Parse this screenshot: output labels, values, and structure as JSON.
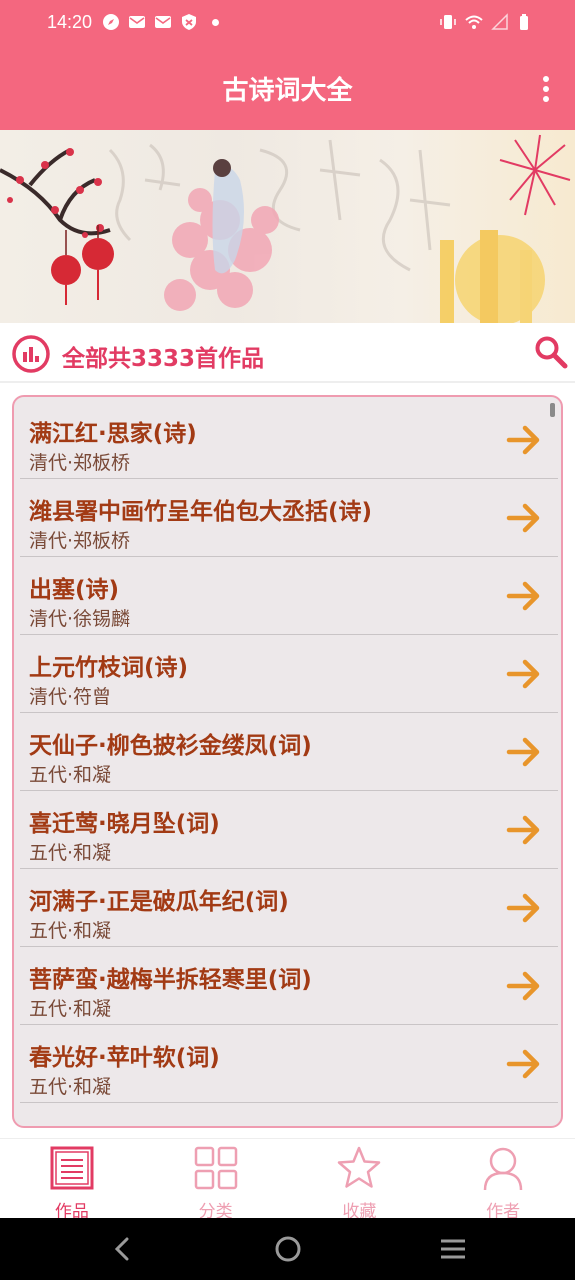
{
  "status_bar": {
    "time": "14:20"
  },
  "app_bar": {
    "title": "古诗词大全"
  },
  "summary": {
    "text": "全部共3333首作品"
  },
  "poems": [
    {
      "title": "满江红·思家(诗)",
      "meta": "清代·郑板桥"
    },
    {
      "title": "潍县署中画竹呈年伯包大丞括(诗)",
      "meta": "清代·郑板桥"
    },
    {
      "title": "出塞(诗)",
      "meta": "清代·徐锡麟"
    },
    {
      "title": "上元竹枝词(诗)",
      "meta": "清代·符曾"
    },
    {
      "title": "天仙子·柳色披衫金缕凤(词)",
      "meta": "五代·和凝"
    },
    {
      "title": "喜迁莺·晓月坠(词)",
      "meta": "五代·和凝"
    },
    {
      "title": "河满子·正是破瓜年纪(词)",
      "meta": "五代·和凝"
    },
    {
      "title": "菩萨蛮·越梅半拆轻寒里(词)",
      "meta": "五代·和凝"
    },
    {
      "title": "春光好·苹叶软(词)",
      "meta": "五代·和凝"
    }
  ],
  "bottom_nav": [
    {
      "label": "作品",
      "icon": "list-icon",
      "active": true
    },
    {
      "label": "分类",
      "icon": "grid-icon",
      "active": false
    },
    {
      "label": "收藏",
      "icon": "star-icon",
      "active": false
    },
    {
      "label": "作者",
      "icon": "person-icon",
      "active": false
    }
  ],
  "colors": {
    "primary": "#f4677f",
    "accent": "#e23b63",
    "title_text": "#a23a14",
    "arrow": "#e8952b",
    "list_bg": "#ede8ea"
  }
}
